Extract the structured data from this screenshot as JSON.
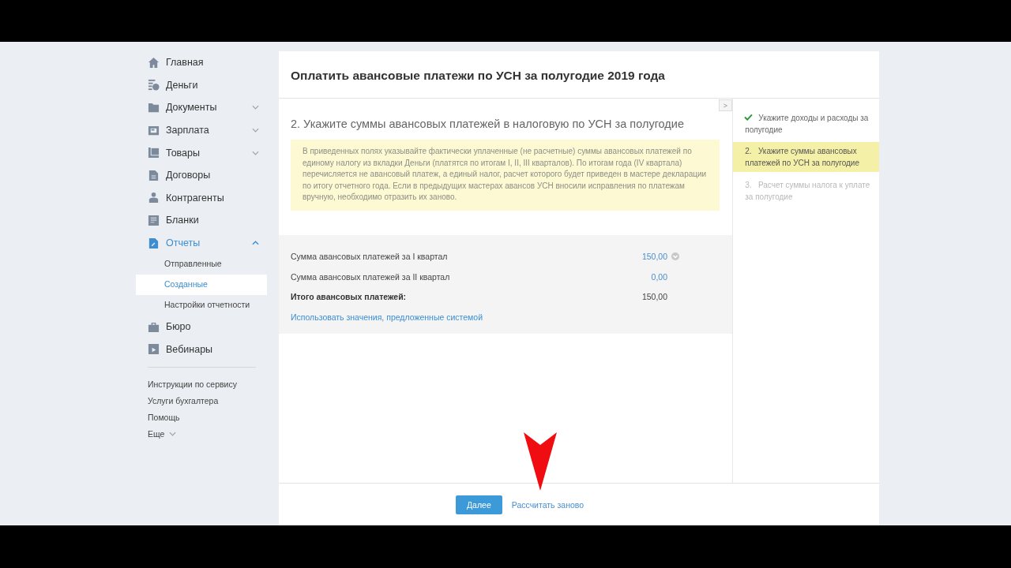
{
  "sidebar": {
    "items": [
      {
        "label": "Главная",
        "kind": "home",
        "selected": false
      },
      {
        "label": "Деньги",
        "kind": "money",
        "selected": false
      },
      {
        "label": "Документы",
        "kind": "folder",
        "expanded": false,
        "selected": false
      },
      {
        "label": "Зарплата",
        "kind": "salary",
        "expanded": false,
        "selected": false
      },
      {
        "label": "Товары",
        "kind": "goods",
        "expanded": false,
        "selected": false
      },
      {
        "label": "Договоры",
        "kind": "contract",
        "selected": false
      },
      {
        "label": "Контрагенты",
        "kind": "person",
        "selected": false
      },
      {
        "label": "Бланки",
        "kind": "forms",
        "selected": false
      },
      {
        "label": "Отчеты",
        "kind": "report",
        "expanded": true,
        "selected": true,
        "children": [
          {
            "label": "Отправленные",
            "selected": false
          },
          {
            "label": "Созданные",
            "selected": true
          },
          {
            "label": "Настройки отчетности",
            "selected": false
          }
        ]
      },
      {
        "label": "Бюро",
        "kind": "briefcase",
        "selected": false
      },
      {
        "label": "Вебинары",
        "kind": "video",
        "selected": false
      }
    ],
    "links": [
      {
        "label": "Инструкции по сервису"
      },
      {
        "label": "Услуги бухгалтера"
      },
      {
        "label": "Помощь"
      },
      {
        "label": "Еще",
        "expanded": false
      }
    ]
  },
  "dialog": {
    "title": "Оплатить авансовые платежи по УСН за полугодие 2019 года",
    "step_heading": "2. Укажите суммы авансовых платежей в налоговую по УСН за полугодие",
    "note": "В приведенных полях указывайте фактически уплаченные (не расчетные) суммы авансовых платежей по единому налогу из вкладки Деньги (платятся по итогам I, II, III кварталов). По итогам года (IV квартала) перечисляется не авансовый платеж, а единый налог, расчет которого будет приведен в мастере декларации по итогу отчетного года. Если в предыдущих мастерах авансов УСН вносили исправления по платежам вручную, необходимо отразить их заново.",
    "rows": [
      {
        "kind": "select",
        "label": "Сумма авансовых платежей за I квартал",
        "value": "150,00"
      },
      {
        "kind": "input",
        "label": "Сумма авансовых платежей за II квартал",
        "value": "0,00"
      },
      {
        "kind": "total",
        "label": "Итого авансовых платежей:",
        "value": "150,00"
      }
    ],
    "suggest_link": "Использовать значения, предложенные системой",
    "collapse_button": ">",
    "steps": [
      {
        "kind": "done",
        "label": "Укажите доходы и расходы за полугодие",
        "selected": false
      },
      {
        "kind": "current",
        "number": "2.",
        "label": "Укажите суммы авансовых платежей по УСН за полугодие",
        "selected": true
      },
      {
        "kind": "pending",
        "number": "3.",
        "label": "Расчет суммы налога к уплате за полугодие",
        "selected": false
      }
    ],
    "buttons": [
      {
        "kind": "primary",
        "label": "Далее"
      },
      {
        "kind": "link",
        "label": "Рассчитать заново"
      }
    ]
  },
  "annotation": {
    "kind": "arrow"
  }
}
